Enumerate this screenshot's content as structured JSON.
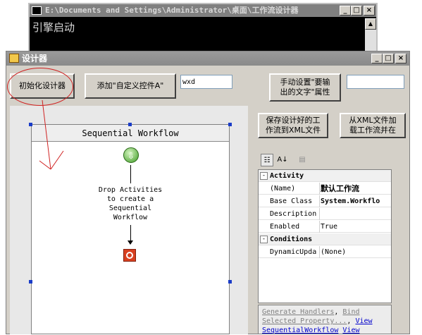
{
  "console": {
    "title": "E:\\Documents and Settings\\Administrator\\桌面\\工作流设计器",
    "output": "引擎启动"
  },
  "designer": {
    "title": "设计器",
    "buttons": {
      "init": "初始化设计器",
      "add_custom": "添加\"自定义控件A\"",
      "set_text_line1": "手动设置\"要输",
      "set_text_line2": "出的文字\"属性",
      "save_line1": "保存设计好的工",
      "save_line2": "作流到XML文件",
      "load_line1": "从XML文件加",
      "load_line2": "载工作流并在"
    },
    "inputs": {
      "custom_name": "wxd",
      "text_value": ""
    }
  },
  "workflow": {
    "header": "Sequential Workflow",
    "drop_text_lines": [
      "Drop Activities",
      "to create a",
      "Sequential",
      "Workflow"
    ]
  },
  "property_grid": {
    "categories": [
      {
        "name": "Activity",
        "rows": [
          {
            "name": "(Name)",
            "value": "默认工作流"
          },
          {
            "name": "Base Class",
            "value": "System.Workflo"
          },
          {
            "name": "Description",
            "value": ""
          },
          {
            "name": "Enabled",
            "value": "True"
          }
        ]
      },
      {
        "name": "Conditions",
        "rows": [
          {
            "name": "DynamicUpda",
            "value": "(None)"
          }
        ]
      }
    ]
  },
  "commands": {
    "generate_handlers": "Generate Handlers",
    "separator": ", ",
    "bind": "Bind",
    "selected_property": "Selected Property...",
    "view": "View",
    "sequential_workflow": "SequentialWorkflow",
    "view2": "View"
  },
  "colors": {
    "console_bg": "#000000",
    "annotation": "#d02020",
    "selection_handle": "#1a3cc8",
    "link": "#0000cc"
  }
}
